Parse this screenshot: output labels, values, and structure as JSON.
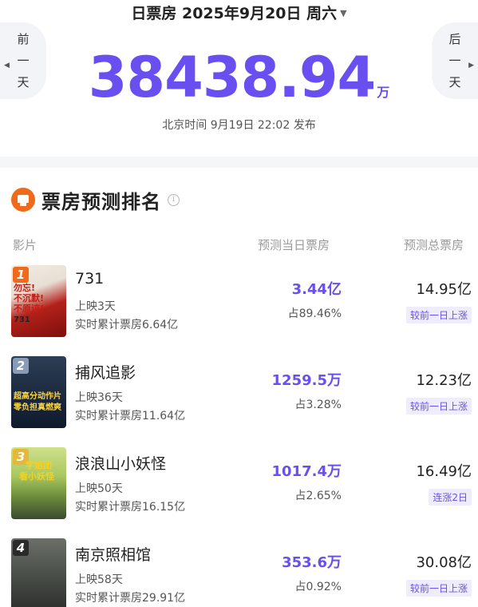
{
  "header": {
    "date_label": "日票房 2025年9月20日 周六",
    "caret_icon": "caret-down-icon",
    "prev": [
      "前",
      "一",
      "天"
    ],
    "next": [
      "后",
      "一",
      "天"
    ],
    "total_value": "38438.94",
    "total_unit": "万",
    "publish_note": "北京时间 9月19日 22:02 发布"
  },
  "section": {
    "title": "票房预测排名",
    "info_icon": "i"
  },
  "columns": {
    "film": "影片",
    "day": "预测当日票房",
    "total": "预测总票房"
  },
  "films": [
    {
      "rank": "1",
      "name": "731",
      "days": "上映3天",
      "cumulative": "实时累计票房6.64亿",
      "day_value": "3.44亿",
      "day_share": "占89.46%",
      "total_value": "14.95亿",
      "trend": "较前一日上涨",
      "poster_text": [
        "勿忘!",
        "不沉默!",
        "不原谅!",
        "731"
      ]
    },
    {
      "rank": "2",
      "name": "捕风追影",
      "days": "上映36天",
      "cumulative": "实时累计票房11.64亿",
      "day_value": "1259.5万",
      "day_share": "占3.28%",
      "total_value": "12.23亿",
      "trend": "较前一日上涨",
      "poster_text": [
        "超高分动作片",
        "零负担真燃爽"
      ]
    },
    {
      "rank": "3",
      "name": "浪浪山小妖怪",
      "days": "上映50天",
      "cumulative": "实时累计票房16.15亿",
      "day_value": "1017.4万",
      "day_share": "占2.65%",
      "total_value": "16.49亿",
      "trend": "连涨2日",
      "poster_text": [
        "学姐团",
        "看小妖怪"
      ]
    },
    {
      "rank": "4",
      "name": "南京照相馆",
      "days": "上映58天",
      "cumulative": "实时累计票房29.91亿",
      "day_value": "353.6万",
      "day_share": "占0.92%",
      "total_value": "30.08亿",
      "trend": "较前一日上涨",
      "poster_text": []
    }
  ],
  "colors": {
    "accent": "#6a4ff0",
    "trend_bg": "#efecfd",
    "logo": "#f06a1c"
  }
}
